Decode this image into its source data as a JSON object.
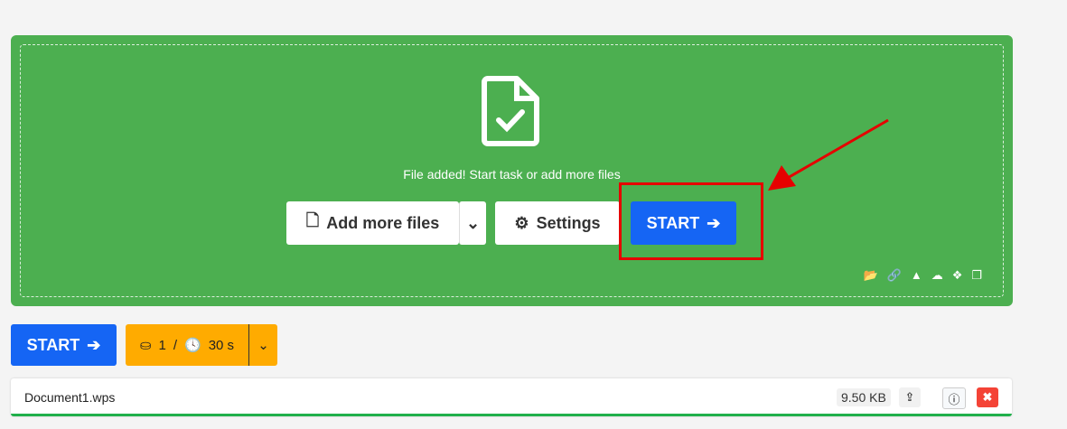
{
  "dropzone": {
    "message": "File added! Start task or add more files",
    "add_more_label": "Add more files",
    "settings_label": "Settings",
    "start_label": "START",
    "sources": [
      "folder-icon",
      "link-icon",
      "google-drive-icon",
      "onedrive-icon",
      "dropbox-icon",
      "clipboard-icon"
    ]
  },
  "toolbar": {
    "start_label": "START",
    "credits": "1",
    "separator": "/",
    "time": "30 s"
  },
  "files": [
    {
      "name": "Document1.wps",
      "size": "9.50 KB"
    }
  ],
  "colors": {
    "green": "#4caf50",
    "blue": "#1565f4",
    "orange": "#ffab00",
    "red": "#f44336"
  }
}
